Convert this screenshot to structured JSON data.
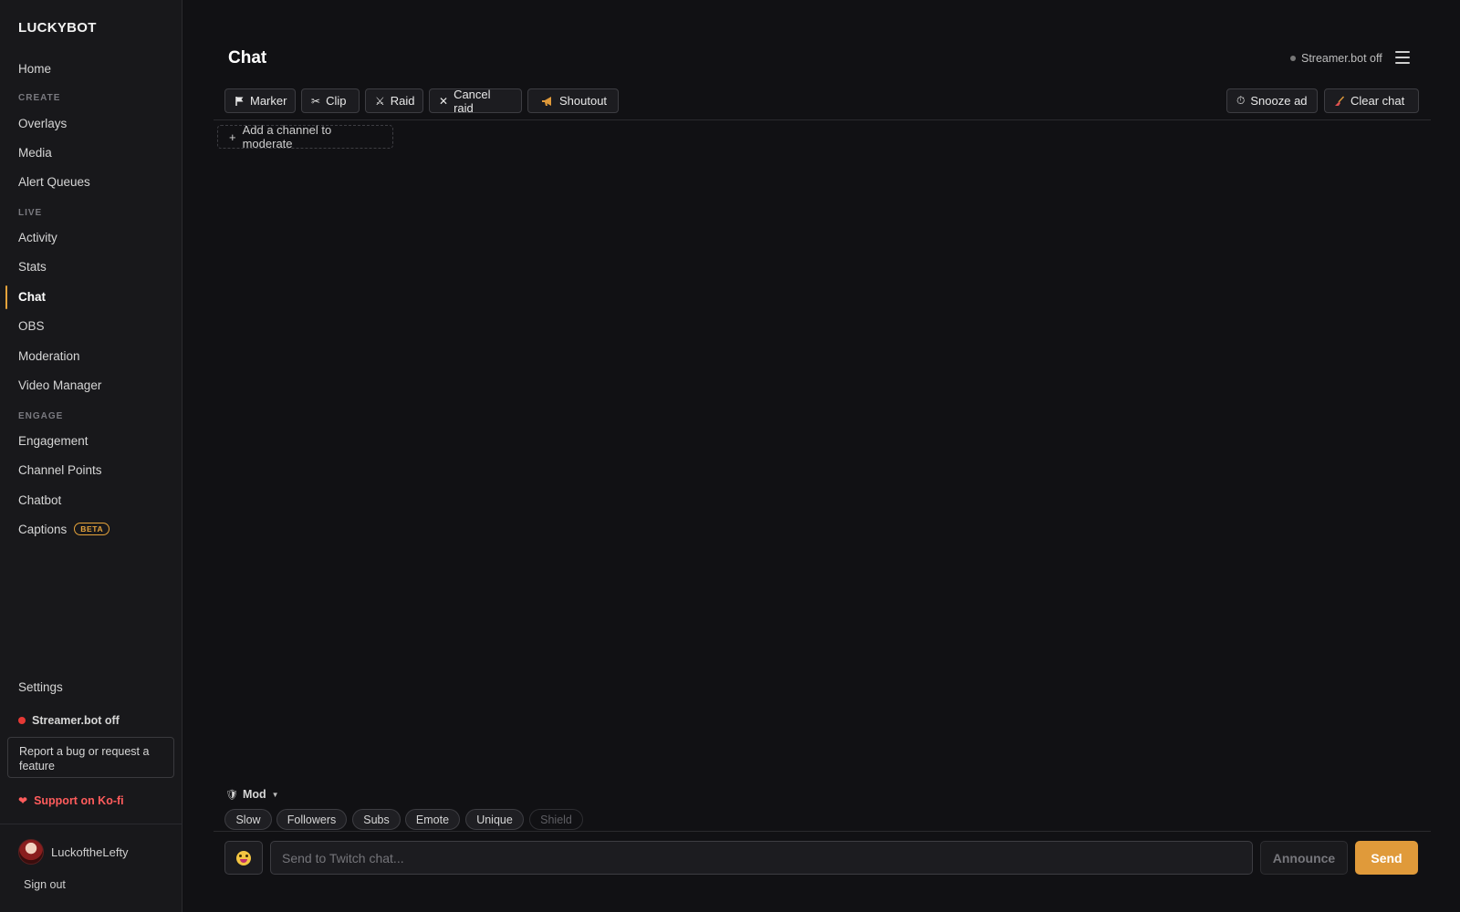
{
  "sidebar": {
    "brand": "LUCKYBOT",
    "home": "Home",
    "sections": {
      "create": "CREATE",
      "live": "LIVE",
      "engage": "ENGAGE"
    },
    "create_items": [
      "Overlays",
      "Media",
      "Alert Queues"
    ],
    "live_items": [
      "Activity",
      "Stats",
      "Chat",
      "OBS",
      "Moderation",
      "Video Manager"
    ],
    "engage_items": [
      "Engagement",
      "Channel Points",
      "Chatbot",
      "Captions"
    ],
    "active_item": "Chat",
    "captions_badge": "BETA",
    "settings": "Settings",
    "streamerbot_status": "Streamer.bot off",
    "report_bug": "Report a bug or request a feature",
    "kofi": "Support on Ko-fi",
    "username": "LuckoftheLefty",
    "sign_out": "Sign out"
  },
  "header": {
    "title": "Chat",
    "status": "Streamer.bot off"
  },
  "toolbar": {
    "left": [
      {
        "label": "Marker",
        "icon": "flag-icon"
      },
      {
        "label": "Clip",
        "icon": "scissors-icon"
      },
      {
        "label": "Raid",
        "icon": "swords-icon"
      },
      {
        "label": "Cancel raid",
        "icon": "close-icon"
      },
      {
        "label": "Shoutout",
        "icon": "megaphone-icon"
      }
    ],
    "right": [
      {
        "label": "Snooze ad",
        "icon": "timer-icon"
      },
      {
        "label": "Clear chat",
        "icon": "broom-icon"
      }
    ]
  },
  "add_channel": "Add a channel to moderate",
  "mod": {
    "label": "Mod",
    "modes": [
      "Slow",
      "Followers",
      "Subs",
      "Emote",
      "Unique",
      "Shield"
    ],
    "disabled_mode": "Shield"
  },
  "composer": {
    "placeholder": "Send to Twitch chat...",
    "announce": "Announce",
    "send": "Send"
  },
  "colors": {
    "accent": "#e09a3a",
    "background": "#111114",
    "sidebar": "#18181b",
    "danger": "#e53935"
  }
}
